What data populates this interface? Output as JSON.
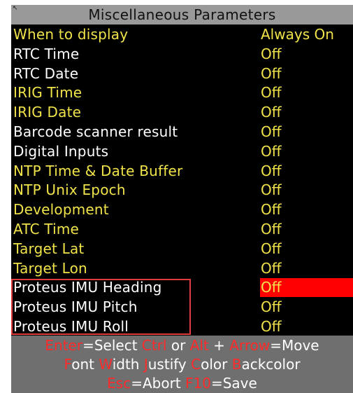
{
  "title": "Miscellaneous Parameters",
  "colors": {
    "label_yellow": "#f0e34a",
    "label_white": "#ffffff",
    "value_yellow": "#f0e34a",
    "selected_bg": "#ff0000",
    "title_bg": "#999999",
    "footer_bg": "#6f6f6f",
    "key_red": "#ff2a2a",
    "highlight_box": "#e03b3b"
  },
  "rows": [
    {
      "label": "When to display",
      "value": "Always On",
      "label_color": "yellow"
    },
    {
      "label": "RTC Time",
      "value": "Off",
      "label_color": "white"
    },
    {
      "label": "RTC Date",
      "value": "Off",
      "label_color": "white"
    },
    {
      "label": "IRIG Time",
      "value": "Off",
      "label_color": "yellow"
    },
    {
      "label": "IRIG Date",
      "value": "Off",
      "label_color": "yellow"
    },
    {
      "label": "Barcode scanner result",
      "value": "Off",
      "label_color": "white"
    },
    {
      "label": "Digital Inputs",
      "value": "Off",
      "label_color": "white"
    },
    {
      "label": "NTP Time & Date Buffer",
      "value": "Off",
      "label_color": "yellow"
    },
    {
      "label": "NTP Unix Epoch",
      "value": "Off",
      "label_color": "yellow"
    },
    {
      "label": "Development",
      "value": "Off",
      "label_color": "yellow"
    },
    {
      "label": "ATC Time",
      "value": "Off",
      "label_color": "yellow"
    },
    {
      "label": "Target Lat",
      "value": "Off",
      "label_color": "yellow"
    },
    {
      "label": "Target Lon",
      "value": "Off",
      "label_color": "yellow"
    },
    {
      "label": "Proteus IMU Heading",
      "value": "Off",
      "label_color": "white",
      "selected": true
    },
    {
      "label": "Proteus IMU Pitch",
      "value": "Off",
      "label_color": "white"
    },
    {
      "label": "Proteus IMU Roll",
      "value": "Off",
      "label_color": "white"
    }
  ],
  "footer": {
    "line1": [
      {
        "text": "Enter",
        "key": true
      },
      {
        "text": "=Select ",
        "key": false
      },
      {
        "text": "Ctrl",
        "key": true
      },
      {
        "text": " or ",
        "key": false
      },
      {
        "text": "Alt",
        "key": true
      },
      {
        "text": " + ",
        "key": false
      },
      {
        "text": "Arrow",
        "key": true
      },
      {
        "text": "=Move",
        "key": false
      }
    ],
    "line2": [
      {
        "text": "F",
        "key": true
      },
      {
        "text": "ont ",
        "key": false
      },
      {
        "text": "W",
        "key": true
      },
      {
        "text": "idth ",
        "key": false
      },
      {
        "text": "J",
        "key": true
      },
      {
        "text": "ustify ",
        "key": false
      },
      {
        "text": "C",
        "key": true
      },
      {
        "text": "olor ",
        "key": false
      },
      {
        "text": "B",
        "key": true
      },
      {
        "text": "ackcolor",
        "key": false
      }
    ],
    "line3": [
      {
        "text": "Esc",
        "key": true
      },
      {
        "text": "=Abort ",
        "key": false
      },
      {
        "text": "F10",
        "key": true
      },
      {
        "text": "=Save",
        "key": false
      }
    ]
  }
}
